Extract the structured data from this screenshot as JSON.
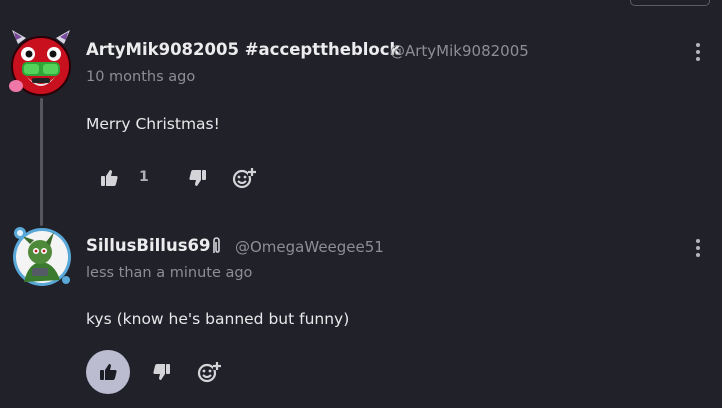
{
  "colors": {
    "background": "#212129",
    "text": "#e8e8ea",
    "muted": "#8d8d95",
    "thread_line": "#56565e",
    "active_like_bg": "#bcbcd0"
  },
  "comments": [
    {
      "display_name": "ArtyMik9082005 #accepttheblock",
      "handle": "@ArtyMik9082005",
      "time": "10 months ago",
      "body": "Merry Christmas!",
      "like_count": "1",
      "icons": [
        "more-vertical-icon",
        "thumbs-up-icon",
        "thumbs-down-icon",
        "add-reaction-icon"
      ]
    },
    {
      "display_name": "SillusBillus69",
      "handle": "@OmegaWeegee51",
      "time": "less than a minute ago",
      "body": "kys (know he's banned but funny)",
      "like_count": "",
      "liked": true,
      "icons": [
        "verified-badge-icon",
        "more-vertical-icon",
        "thumbs-up-icon",
        "thumbs-down-icon",
        "add-reaction-icon"
      ]
    }
  ]
}
